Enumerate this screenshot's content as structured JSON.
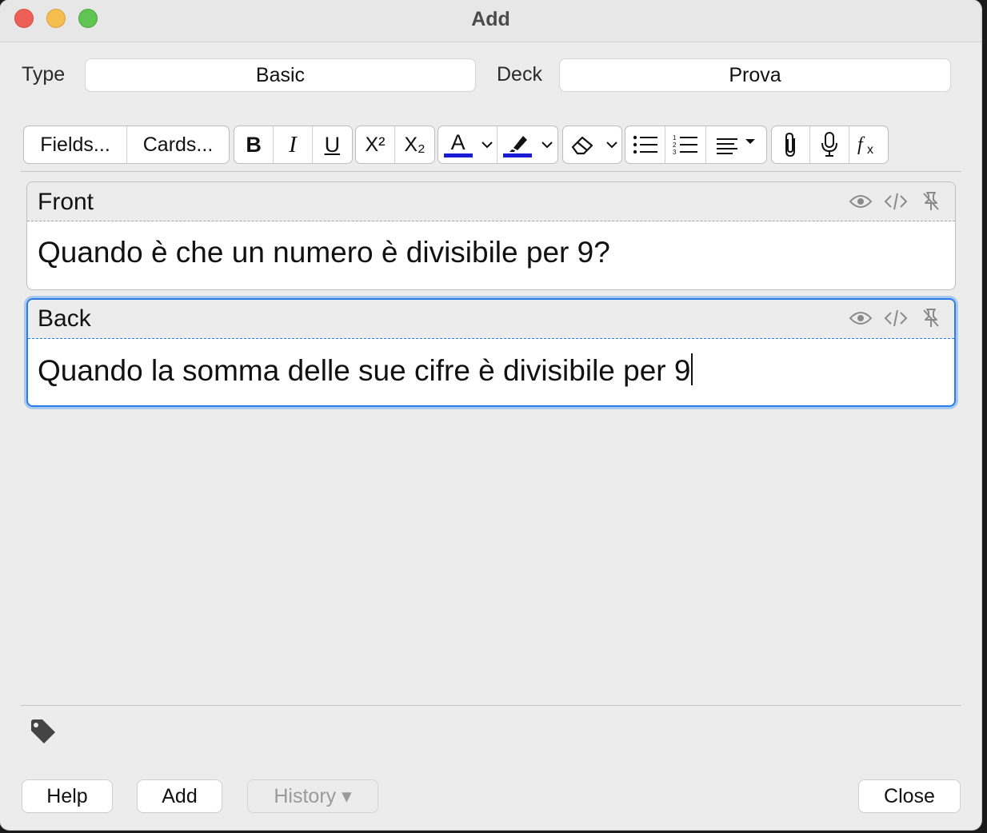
{
  "window": {
    "title": "Add"
  },
  "note_type": {
    "label": "Type",
    "value": "Basic"
  },
  "deck": {
    "label": "Deck",
    "value": "Prova"
  },
  "toolbar": {
    "fields_label": "Fields...",
    "cards_label": "Cards...",
    "bold_label": "B",
    "italic_label": "I",
    "underline_label": "U",
    "superscript_label": "X²",
    "subscript_label": "X₂",
    "text_color_label": "A",
    "text_color": "#1b1bd6",
    "highlight_color": "#1b1bd6",
    "icons": [
      "bold-icon",
      "italic-icon",
      "underline-icon",
      "superscript-icon",
      "subscript-icon",
      "text-color-icon",
      "highlight-icon",
      "eraser-icon",
      "bullet-list-icon",
      "numbered-list-icon",
      "align-icon",
      "paperclip-icon",
      "microphone-icon",
      "formula-icon"
    ]
  },
  "fields": [
    {
      "name": "Front",
      "content": "Quando è che un numero è divisibile per 9?"
    },
    {
      "name": "Back",
      "content": "Quando la somma delle sue cifre è divisibile per 9"
    }
  ],
  "footer": {
    "help_label": "Help",
    "add_label": "Add",
    "history_label": "History ▾",
    "close_label": "Close"
  },
  "colors": {
    "focus": "#2a7ce8"
  }
}
